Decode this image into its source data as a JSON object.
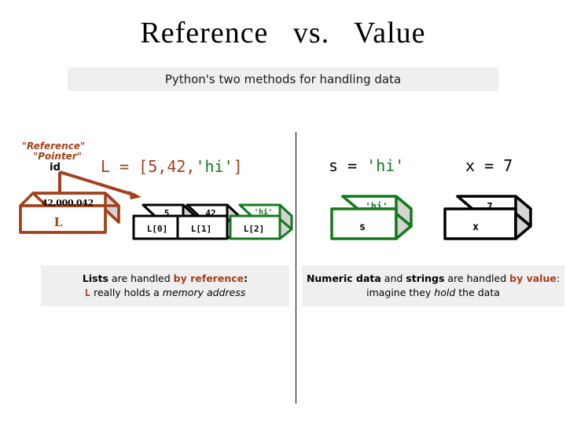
{
  "slide": {
    "title": "Reference   vs.   Value",
    "subtitle": "Python's two methods for handling data"
  },
  "colors": {
    "brown": "#a3401a",
    "green": "#13791b",
    "black": "#000000",
    "panel_gray": "#efefef",
    "box_side_gray": "#d4d4d4"
  },
  "reference_side": {
    "pointer_labels": {
      "line1": "\"Reference\"",
      "line2": "\"Pointer\"",
      "line3": "id"
    },
    "memory_box": {
      "top_value": "42,000,042",
      "front_label": "L"
    },
    "code": {
      "prefix": "L = ",
      "bracket_open": "[",
      "item0": "5",
      "comma0": ",",
      "item1": "42",
      "comma1": ",",
      "item2": "'hi'",
      "bracket_close": "]"
    },
    "elements": [
      {
        "top_value": "5",
        "front_label": "L[0]",
        "color": "#000000"
      },
      {
        "top_value": "42",
        "front_label": "L[1]",
        "color": "#000000"
      },
      {
        "top_value": "'hi'",
        "front_label": "L[2]",
        "color": "#13791b"
      }
    ],
    "caption": {
      "part1": "Lists",
      "part2": " are handled ",
      "part3": "by reference",
      "part4": ":",
      "part5": "L",
      "part6": " really holds a ",
      "part7": "memory address"
    }
  },
  "value_side": {
    "statements": [
      {
        "code_prefix": "s = ",
        "code_value": "'hi'",
        "value_color": "#13791b"
      },
      {
        "code_prefix": "x = ",
        "code_value": "7",
        "value_color": "#000000"
      }
    ],
    "boxes": [
      {
        "top_value": "'hi'",
        "front_label": "s",
        "color": "#13791b"
      },
      {
        "top_value": "7",
        "front_label": "x",
        "color": "#000000"
      }
    ],
    "caption": {
      "part1": "Numeric data",
      "part2": " and ",
      "part3": "strings",
      "part4": " are handled ",
      "part5": "by value",
      "part6": ": imagine they ",
      "part7": "hold",
      "part8": " the data"
    }
  }
}
